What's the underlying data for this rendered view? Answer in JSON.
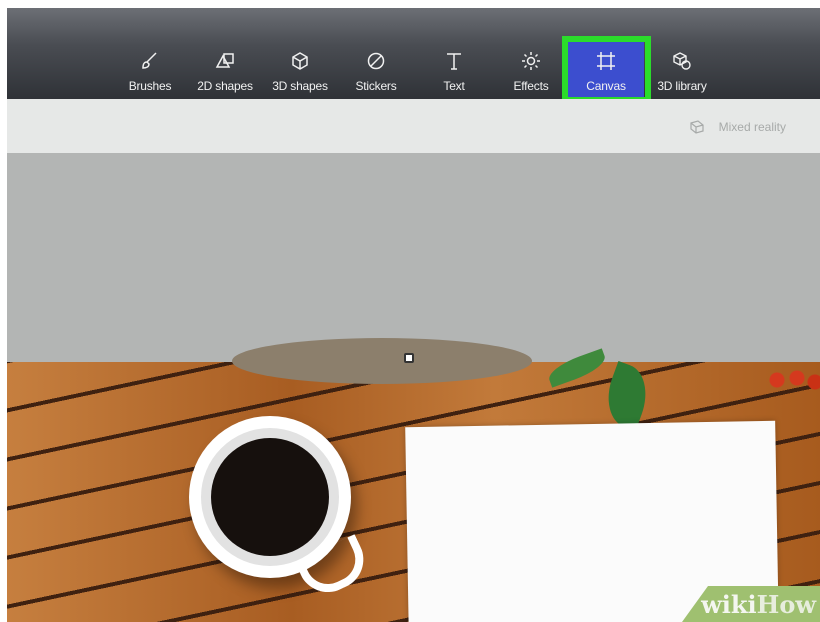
{
  "toolbar": {
    "tools": [
      {
        "label": "Brushes",
        "icon": "brush-icon"
      },
      {
        "label": "2D shapes",
        "icon": "2d-shapes-icon"
      },
      {
        "label": "3D shapes",
        "icon": "3d-shapes-icon"
      },
      {
        "label": "Stickers",
        "icon": "stickers-icon"
      },
      {
        "label": "Text",
        "icon": "text-icon"
      },
      {
        "label": "Effects",
        "icon": "effects-icon"
      },
      {
        "label": "Canvas",
        "icon": "canvas-icon",
        "active": true
      },
      {
        "label": "3D library",
        "icon": "3d-library-icon"
      }
    ],
    "active_color": "#3c4ecf",
    "highlight_color": "#2bdc2b"
  },
  "subbar": {
    "mixed_reality_label": "Mixed reality",
    "mixed_reality_icon": "mixed-reality-icon"
  },
  "watermark": {
    "part1": "wiki",
    "part2": "How"
  }
}
